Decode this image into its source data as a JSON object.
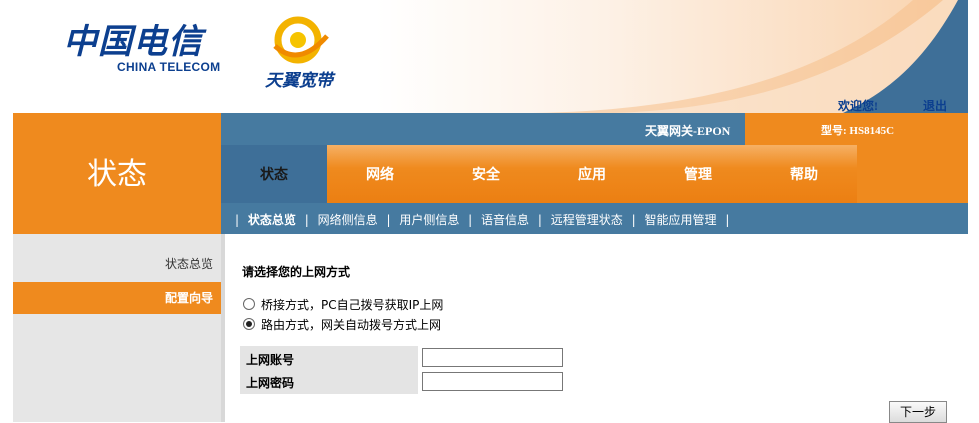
{
  "header": {
    "logo_chinese": "中国电信",
    "logo_english": "CHINA TELECOM",
    "brand": "天翼宽带",
    "welcome": "欢迎您!",
    "logout": "退出"
  },
  "info_bar": {
    "gateway_name": "天翼网关-EPON",
    "model": "型号: HS8145C"
  },
  "section_title": "状态",
  "nav": {
    "tabs": [
      {
        "label": "状态",
        "active": true
      },
      {
        "label": "网络"
      },
      {
        "label": "安全"
      },
      {
        "label": "应用"
      },
      {
        "label": "管理"
      },
      {
        "label": "帮助"
      }
    ]
  },
  "subnav": {
    "items": [
      {
        "label": "状态总览",
        "active": true
      },
      {
        "label": "网络侧信息"
      },
      {
        "label": "用户侧信息"
      },
      {
        "label": "语音信息"
      },
      {
        "label": "远程管理状态"
      },
      {
        "label": "智能应用管理"
      }
    ]
  },
  "sidebar": {
    "items": [
      {
        "label": "状态总览"
      },
      {
        "label": "配置向导",
        "active": true
      }
    ]
  },
  "content": {
    "title": "请选择您的上网方式",
    "options": [
      {
        "label": "桥接方式，PC自己拨号获取IP上网",
        "checked": false
      },
      {
        "label": "路由方式，网关自动拨号方式上网",
        "checked": true
      }
    ],
    "account_label": "上网账号",
    "password_label": "上网密码",
    "account_value": "",
    "password_value": "",
    "next_button": "下一步"
  },
  "colors": {
    "orange": "#ef8a1e",
    "blue": "#467aa0",
    "dark_blue": "#0c3f8f"
  }
}
